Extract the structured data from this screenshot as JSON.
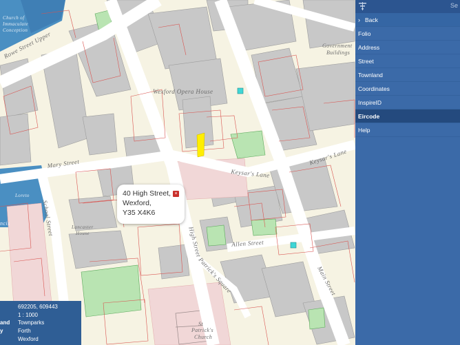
{
  "popup": {
    "line1": "40 High Street,",
    "line2": "Wexford,",
    "line3": "Y35 X4K6",
    "close_glyph": "×"
  },
  "map_labels": {
    "church_top": "Church of",
    "church_top2": "Immaculate",
    "church_top3": "Conception",
    "rowe_street": "Rowe Street Upper",
    "opera_house": "Wexford Opera House",
    "government": "Government",
    "buildings": "Buildings",
    "mary_street": "Mary Street",
    "keysars_lane": "Keysar's Lane",
    "keysars_lane2": "Keysar's Lane",
    "school_street": "School Street",
    "school_name": "Loreto",
    "lancaster": "Lancaster",
    "house": "House",
    "high_street": "High Street",
    "allen_street": "Allen Street",
    "patricks_square": "Patrick's Square",
    "main_street": "Main Street",
    "st_patricks": "St",
    "st_patricks2": "Patrick's",
    "church": "Church",
    "ncis": "ncis"
  },
  "infobox": {
    "coords": "692205, 609443",
    "scale": "1 : 1000",
    "townland_key": "and",
    "townland_value": "Townparks",
    "barony_key": "y",
    "barony_value": "Forth",
    "county_value": "Wexford"
  },
  "panel": {
    "top_right": "Se",
    "menu": [
      {
        "label": "Back"
      },
      {
        "label": "Folio"
      },
      {
        "label": "Address"
      },
      {
        "label": "Street"
      },
      {
        "label": "Townland"
      },
      {
        "label": "Coordinates"
      },
      {
        "label": "InspireID"
      },
      {
        "label": "Eircode"
      },
      {
        "label": "Help"
      }
    ],
    "active_index": 7,
    "colors": {
      "panel_bg": "#3b6aa8",
      "active_bg": "#244a7e",
      "infobox_bg": "#2f5e95",
      "highlight_parcel": "#ffee00",
      "parcel_line": "#d9534f"
    }
  },
  "icons": {
    "filter": "filter-icon",
    "back_chevron": "chevron-left-icon",
    "popup_close": "close-icon"
  }
}
